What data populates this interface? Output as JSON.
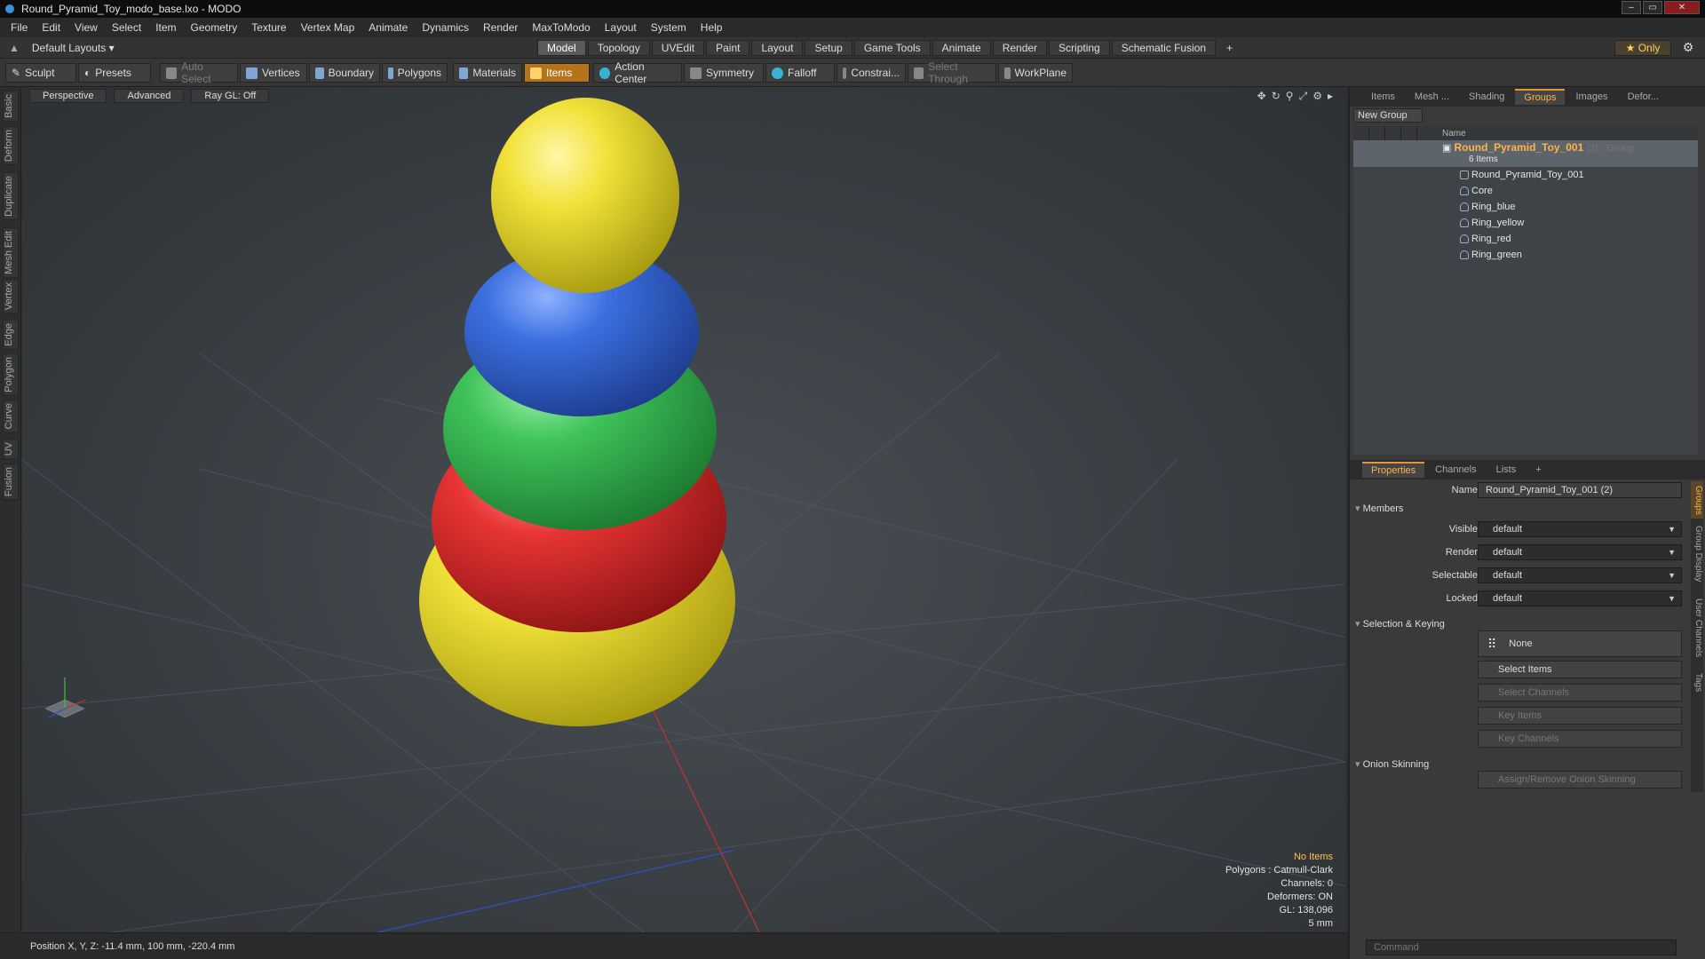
{
  "window": {
    "title": "Round_Pyramid_Toy_modo_base.lxo - MODO",
    "minimize": "–",
    "maximize": "▭",
    "close": "✕"
  },
  "menu": [
    "File",
    "Edit",
    "View",
    "Select",
    "Item",
    "Geometry",
    "Texture",
    "Vertex Map",
    "Animate",
    "Dynamics",
    "Render",
    "MaxToModo",
    "Layout",
    "System",
    "Help"
  ],
  "modebar": {
    "layouts": "Default Layouts",
    "tabs": [
      "Model",
      "Topology",
      "UVEdit",
      "Paint",
      "Layout",
      "Setup",
      "Game Tools",
      "Animate",
      "Render",
      "Scripting",
      "Schematic Fusion"
    ],
    "active_tab": "Model",
    "add_tab": "+",
    "only": "★ Only"
  },
  "toolbar": {
    "sculpt": "Sculpt",
    "presets": "Presets",
    "auto_select": "Auto Select",
    "vertices": "Vertices",
    "boundary": "Boundary",
    "polygons": "Polygons",
    "materials": "Materials",
    "items": "Items",
    "action_center": "Action Center",
    "symmetry": "Symmetry",
    "falloff": "Falloff",
    "constrain": "Constrai...",
    "select_through": "Select Through",
    "workplane": "WorkPlane"
  },
  "left_tabs": [
    "Basic",
    "Deform",
    "Duplicate",
    "Mesh Edit",
    "Vertex",
    "Edge",
    "Polygon",
    "Curve",
    "UV",
    "Fusion"
  ],
  "viewport": {
    "view": "Perspective",
    "shading": "Advanced",
    "raygl": "Ray GL: Off",
    "info": {
      "no_items": "No Items",
      "polygons": "Polygons : Catmull-Clark",
      "channels": "Channels: 0",
      "deformers": "Deformers: ON",
      "gl": "GL: 138,096",
      "scale": "5 mm"
    },
    "colors": {
      "yellow": "#f2e23a",
      "blue": "#3c6fe0",
      "green": "#3fc35a",
      "red": "#e83434"
    }
  },
  "status": {
    "position": "Position X, Y, Z:  -11.4 mm, 100 mm, -220.4 mm"
  },
  "top_panel": {
    "tabs": [
      "Items",
      "Mesh ...",
      "Shading",
      "Groups",
      "Images",
      "Defor..."
    ],
    "active_tab": "Groups",
    "new_group": "New Group",
    "name_col": "Name",
    "group": {
      "name": "Round_Pyramid_Toy_001",
      "count": "(2)",
      "type": ": Group",
      "items_label": "6 Items"
    },
    "children": [
      "Round_Pyramid_Toy_001",
      "Core",
      "Ring_blue",
      "Ring_yellow",
      "Ring_red",
      "Ring_green"
    ]
  },
  "bottom_panel": {
    "tabs": [
      "Properties",
      "Channels",
      "Lists"
    ],
    "active_tab": "Properties",
    "add": "+",
    "name_label": "Name",
    "name_value": "Round_Pyramid_Toy_001 (2)",
    "members": "Members",
    "visible": {
      "label": "Visible",
      "value": "default"
    },
    "render": {
      "label": "Render",
      "value": "default"
    },
    "selectable": {
      "label": "Selectable",
      "value": "default"
    },
    "locked": {
      "label": "Locked",
      "value": "default"
    },
    "selection_keying": "Selection & Keying",
    "none": "None",
    "select_items": "Select Items",
    "select_channels": "Select Channels",
    "key_items": "Key Items",
    "key_channels": "Key Channels",
    "onion": "Onion Skinning",
    "onion_btn": "Assign/Remove Onion Skinning",
    "side_tabs": [
      "Groups",
      "Group Display",
      "User Channels",
      "Tags"
    ]
  },
  "command": {
    "placeholder": "Command"
  }
}
